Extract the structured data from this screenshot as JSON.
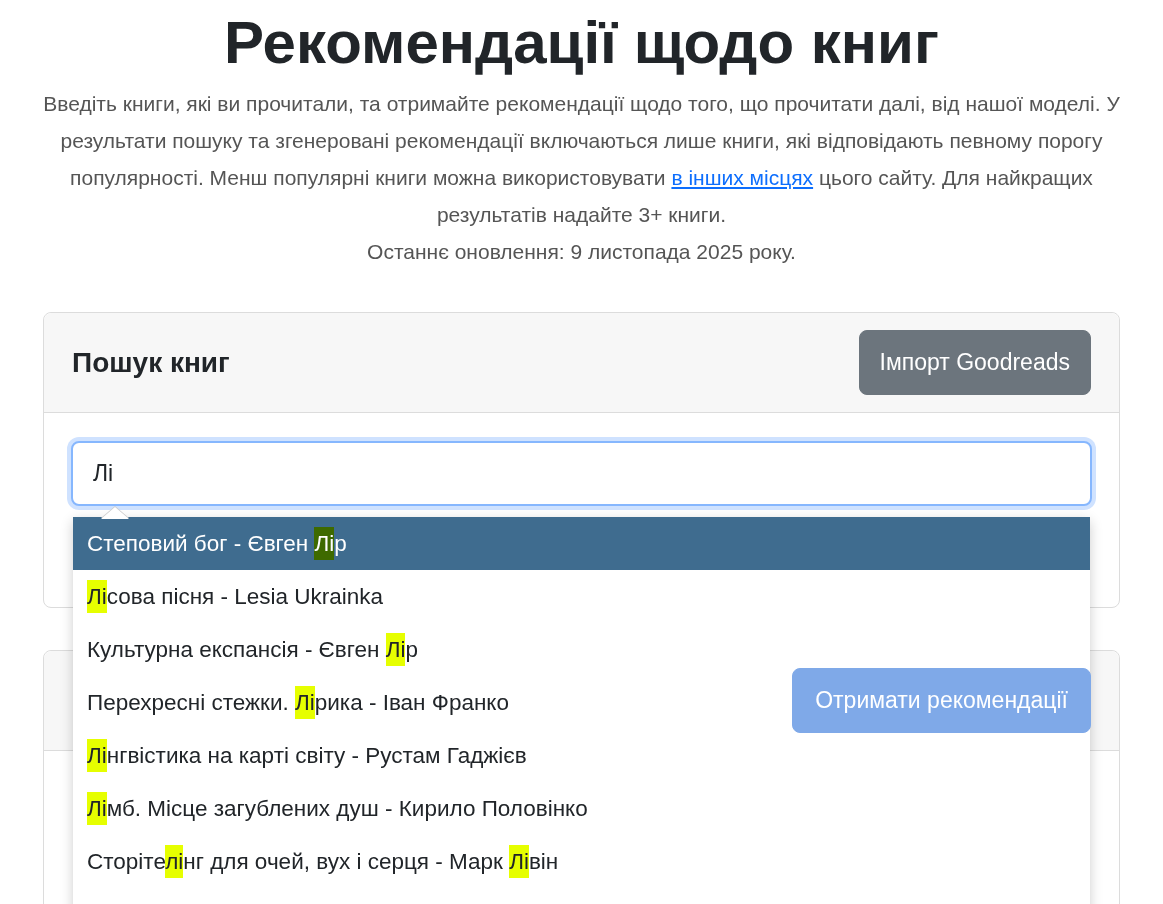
{
  "title": "Рекомендації щодо книг",
  "intro": {
    "before": "Введіть книги, які ви прочитали, та отримайте рекомендації щодо того, що прочитати далі, від нашої моделі. У результати пошуку та згенеровані рекомендації включаються лише книги, які відповідають певному порогу популярності. Менш популярні книги можна використовувати ",
    "link": "в інших місцях",
    "after": " цього сайту. Для найкращих результатів надайте 3+ книги."
  },
  "updated": "Останнє оновлення: 9 листопада 2025 року.",
  "search_card": {
    "title": "Пошук книг",
    "import_button": "Імпорт Goodreads",
    "search_value": "Лі",
    "suggestions": [
      {
        "selected": true,
        "parts": [
          {
            "text": "Степовий бог - Євген "
          },
          {
            "text": "Лі",
            "match": true
          },
          {
            "text": "р"
          }
        ]
      },
      {
        "selected": false,
        "parts": [
          {
            "text": "Лі",
            "match": true
          },
          {
            "text": "сова пісня - Lesia Ukrainka"
          }
        ]
      },
      {
        "selected": false,
        "parts": [
          {
            "text": "Культурна експансія - Євген "
          },
          {
            "text": "Лі",
            "match": true
          },
          {
            "text": "р"
          }
        ]
      },
      {
        "selected": false,
        "parts": [
          {
            "text": "Перехресні стежки. "
          },
          {
            "text": "Лі",
            "match": true
          },
          {
            "text": "рика - Іван Франко"
          }
        ]
      },
      {
        "selected": false,
        "parts": [
          {
            "text": "Лі",
            "match": true
          },
          {
            "text": "нгвістика на карті світу - Рустам Гаджієв"
          }
        ]
      },
      {
        "selected": false,
        "parts": [
          {
            "text": "Лі",
            "match": true
          },
          {
            "text": "мб. Місце загублених душ - Кирило Половінко"
          }
        ]
      },
      {
        "selected": false,
        "parts": [
          {
            "text": "Сторіте"
          },
          {
            "text": "лі",
            "match": true
          },
          {
            "text": "нг для очей, вух і серця - Марк "
          },
          {
            "text": "Лі",
            "match": true
          },
          {
            "text": "він"
          }
        ]
      }
    ]
  },
  "recommend_card": {
    "button": "Отримати рекомендації",
    "disabled": true
  }
}
